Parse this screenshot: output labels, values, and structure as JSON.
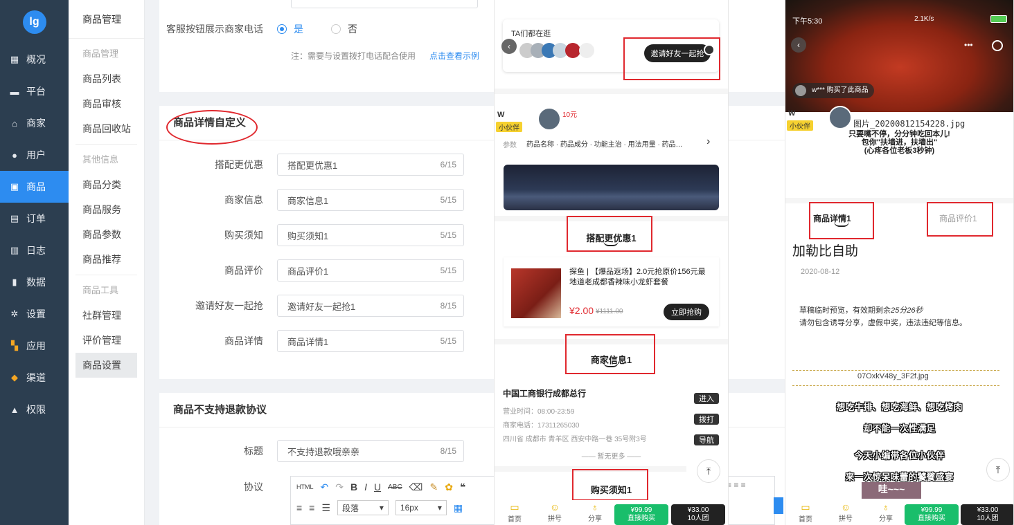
{
  "sidebar": {
    "logo": "lg",
    "items": [
      {
        "label": "概况",
        "icon": "chart-icon"
      },
      {
        "label": "平台",
        "icon": "monitor-icon"
      },
      {
        "label": "商家",
        "icon": "store-icon"
      },
      {
        "label": "用户",
        "icon": "user-icon"
      },
      {
        "label": "商品",
        "icon": "bag-icon"
      },
      {
        "label": "订单",
        "icon": "clipboard-icon"
      },
      {
        "label": "日志",
        "icon": "book-icon"
      },
      {
        "label": "数据",
        "icon": "bar-chart-icon"
      },
      {
        "label": "设置",
        "icon": "gear-icon"
      },
      {
        "label": "应用",
        "icon": "apps-icon"
      },
      {
        "label": "渠道",
        "icon": "cube-icon"
      },
      {
        "label": "权限",
        "icon": "lock-icon"
      }
    ]
  },
  "submenu": {
    "title": "商品管理",
    "group1": "商品管理",
    "g1_items": [
      "商品列表",
      "商品审核",
      "商品回收站"
    ],
    "group2": "其他信息",
    "g2_items": [
      "商品分类",
      "商品服务",
      "商品参数",
      "商品推荐"
    ],
    "group3": "商品工具",
    "g3_items": [
      "社群管理",
      "评价管理",
      "商品设置"
    ]
  },
  "form": {
    "top_partial": "",
    "service_label": "客服按钮展示商家电话",
    "yes": "是",
    "no": "否",
    "note": "注：需要与设置拨打电话配合使用",
    "note_link": "点击查看示例",
    "section_title": "商品详情自定义",
    "fields": [
      {
        "label": "搭配更优惠",
        "value": "搭配更优惠1",
        "count": "6/15"
      },
      {
        "label": "商家信息",
        "value": "商家信息1",
        "count": "5/15"
      },
      {
        "label": "购买须知",
        "value": "购买须知1",
        "count": "5/15"
      },
      {
        "label": "商品评价",
        "value": "商品评价1",
        "count": "5/15"
      },
      {
        "label": "邀请好友一起抢",
        "value": "邀请好友一起抢1",
        "count": "8/15"
      },
      {
        "label": "商品详情",
        "value": "商品详情1",
        "count": "5/15"
      }
    ],
    "refund_title": "商品不支持退款协议",
    "refund_label": "标题",
    "refund_value": "不支持退款哦亲亲",
    "refund_count": "8/15",
    "agreement_label": "协议",
    "editor": {
      "html": "HTML",
      "paragraph": "段落",
      "fontsize": "16px"
    }
  },
  "phone1": {
    "ta_text": "TA们都在逛",
    "invite_btn": "邀请好友一起抢",
    "user_w": "W",
    "user_badge": "小伙伴",
    "price_tag": "10元",
    "params_label": "参数",
    "params_text": "药品名称 · 药品成分 · 功能主治 · 用法用量 · 药品…",
    "combo_title": "搭配更优惠1",
    "product_name": "探鱼 | 【爆品返场】2.0元抢原价156元最地道老成都香辣味小龙虾套餐",
    "product_price": "¥2.00",
    "product_old": "¥1111.00",
    "buy_btn": "立即抢购",
    "merchant_title": "商家信息1",
    "merchant_name": "中国工商银行成都总行",
    "hours": "营业时间：08:00-23:59",
    "phone": "商家电话：17311265030",
    "address": "四川省 成都市 青羊区 西安中路一巷 35号附3号",
    "enter": "进入",
    "call": "拨打",
    "nav": "导航",
    "no_more": "—— 暂无更多 ——",
    "notice_title": "购买须知1",
    "bottom": {
      "home": "首页",
      "mid": "拼号",
      "share": "分享",
      "green_price": "¥99.99",
      "green_label": "直接购买",
      "black_price": "¥33.00",
      "black_label": "10人团"
    }
  },
  "phone2": {
    "status_time": "下午5:30",
    "status_right": "2.1K/s",
    "buyer": "w*** 购买了此商品",
    "user_w": "W",
    "user_badge": "小伙伴",
    "image_file": "图片_20200812154228.jpg",
    "slogan1": "只要嘴不停，分分钟吃回本儿!",
    "slogan2": "包你\"扶墙进，扶墙出\"",
    "slogan3": "(心疼各位老板3秒钟)",
    "tab_detail": "商品详情1",
    "tab_review": "商品评价1",
    "article_title": "加勒比自助",
    "article_date": "2020-08-12",
    "draft1_a": "草稿临时预览，有效期剩余",
    "draft1_b": "25分26秒",
    "draft2": "请勿包含诱导分享，虚假中奖，违法违纪等信息。",
    "img_alt": "07OxkV48y_3F2f.jpg",
    "cap1": "想吃牛排、想吃海鲜、想吃烤肉",
    "cap2": "却不能一次性满足",
    "cap3": "今天小编带各位小伙伴",
    "cap4": "来一次惊呆味蕾的饕餮盛宴",
    "cap5": "哇~~~",
    "bottom": {
      "home": "首页",
      "mid": "拼号",
      "share": "分享",
      "green_price": "¥99.99",
      "green_label": "直接购买",
      "black_price": "¥33.00",
      "black_label": "10人团"
    }
  }
}
